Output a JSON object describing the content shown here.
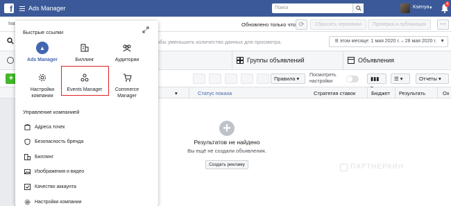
{
  "topbar": {
    "logo": "f",
    "title": "Ads Manager",
    "search_placeholder": "Поиск",
    "username": "Ksenya",
    "notification_count": "4"
  },
  "account_row": {
    "account_name_partial": "Iva",
    "updated_label": "Обновлено только что",
    "discard_label": "Сбросить черновики",
    "review_publish_label": "Проверка и публикация",
    "more_label": "···"
  },
  "search_row": {
    "hint": "обы уменьшить количество данных для просмотра.",
    "date_range": "В этом месяце: 1 мая 2020 г. – 28 мая 2020 г."
  },
  "tabs": [
    {
      "label": "Группы объявлений"
    },
    {
      "label": "Объявления"
    }
  ],
  "toolbar": {
    "add_label": "+",
    "rules_label": "Правила",
    "preview_label_line1": "Посмотреть",
    "preview_label_line2": "настройки",
    "reports_label": "Отчеты"
  },
  "table": {
    "columns": [
      "Статус показа",
      "Стратегия ставок",
      "Бюджет",
      "Результать",
      "Ох"
    ]
  },
  "empty_state": {
    "title": "Результатов не найдено",
    "subtitle": "Вы ещё не создали объявления.",
    "button": "Создать рекламу"
  },
  "watermark": "ПАРТНЕРКИН",
  "panel": {
    "quick_links_title": "Быстрые ссылки",
    "quick_links": [
      {
        "label": "Ads Manager",
        "icon": "ads-manager-icon"
      },
      {
        "label": "Биллинг",
        "icon": "billing-icon"
      },
      {
        "label": "Аудитории",
        "icon": "audiences-icon"
      },
      {
        "label": "Настройки компании",
        "icon": "gear-icon"
      },
      {
        "label": "Events Manager",
        "icon": "events-manager-icon"
      },
      {
        "label": "Commerce Manager",
        "icon": "cart-icon"
      }
    ],
    "manage_title": "Управление компанией",
    "manage_items": [
      {
        "label": "Адреса точек",
        "icon": "location-icon"
      },
      {
        "label": "Безопасность бренда",
        "icon": "shield-icon"
      },
      {
        "label": "Биллинг",
        "icon": "billing-icon"
      },
      {
        "label": "Изображения и видео",
        "icon": "media-icon"
      },
      {
        "label": "Качество аккаунта",
        "icon": "quality-icon"
      },
      {
        "label": "Настройки компании",
        "icon": "gear-icon"
      }
    ]
  },
  "colors": {
    "topbar": "#3b5998",
    "accent": "#4267b2",
    "highlight": "#e02020",
    "add_button": "#42b72a"
  }
}
